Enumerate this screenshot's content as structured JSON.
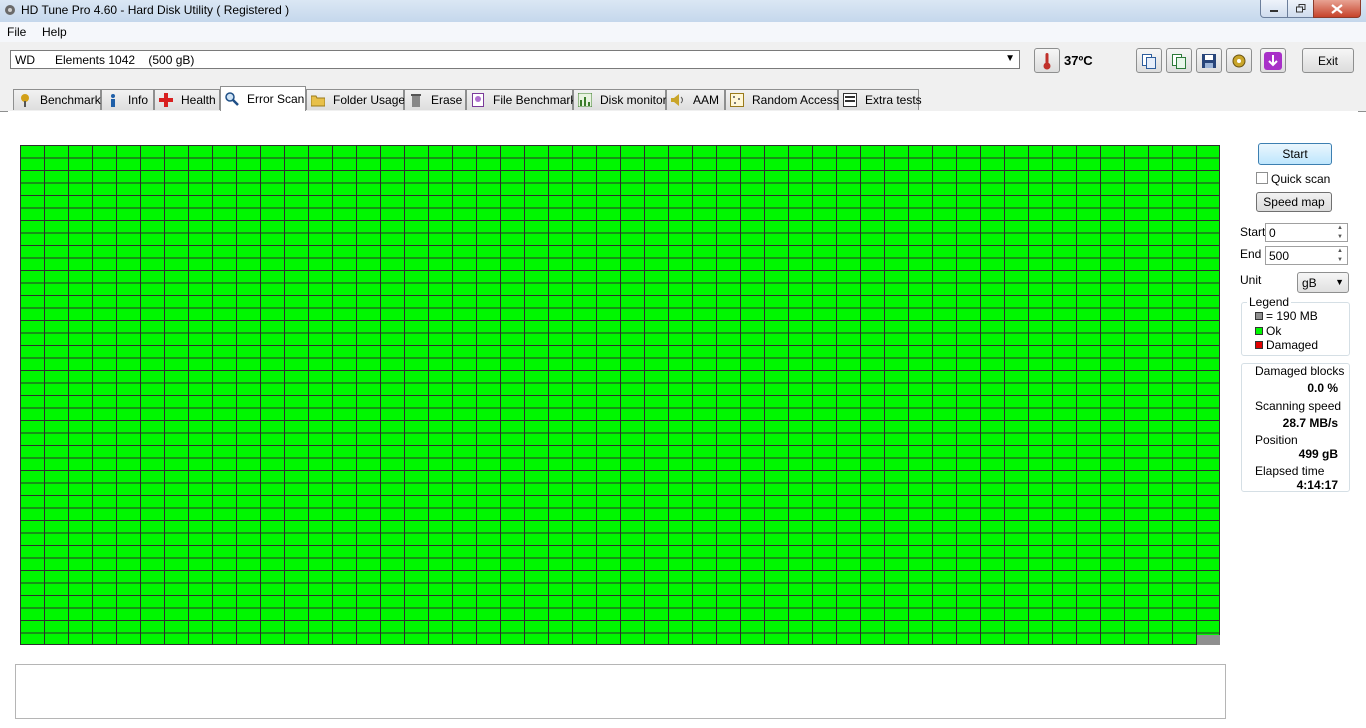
{
  "window": {
    "title": "HD Tune Pro 4.60 - Hard Disk Utility (  Registered )"
  },
  "menu": {
    "file": "File",
    "help": "Help"
  },
  "toolbar": {
    "drive": "WD      Elements 1042    (500 gB)",
    "temperature": "37ºC",
    "exit_label": "Exit"
  },
  "tabs": [
    {
      "label": "Benchmark",
      "icon": "benchmark-icon"
    },
    {
      "label": "Info",
      "icon": "info-icon"
    },
    {
      "label": "Health",
      "icon": "health-icon"
    },
    {
      "label": "Error Scan",
      "icon": "magnifier-icon",
      "active": true
    },
    {
      "label": "Folder Usage",
      "icon": "folder-icon"
    },
    {
      "label": "Erase",
      "icon": "trash-icon"
    },
    {
      "label": "File Benchmark",
      "icon": "file-benchmark-icon"
    },
    {
      "label": "Disk monitor",
      "icon": "disk-monitor-icon"
    },
    {
      "label": "AAM",
      "icon": "speaker-icon"
    },
    {
      "label": "Random Access",
      "icon": "random-access-icon"
    },
    {
      "label": "Extra tests",
      "icon": "extra-tests-icon"
    }
  ],
  "scan": {
    "start_label": "Start",
    "quick_scan_label": "Quick scan",
    "quick_scan_checked": false,
    "speed_map_label": "Speed map",
    "start_field_label": "Start",
    "start_value": "0",
    "end_field_label": "End",
    "end_value": "500",
    "unit_label": "Unit",
    "unit_value": "gB",
    "grid_status": "all blocks ok; last block pending",
    "colors": {
      "ok": "#00f700",
      "damaged": "#e00000",
      "block": "#8f8f8f"
    }
  },
  "legend": {
    "title": "Legend",
    "block": "= 190 MB",
    "ok": "Ok",
    "damaged": "Damaged"
  },
  "stats": {
    "damaged_blocks_label": "Damaged blocks",
    "damaged_blocks_value": "0.0 %",
    "scanning_speed_label": "Scanning speed",
    "scanning_speed_value": "28.7 MB/s",
    "position_label": "Position",
    "position_value": "499 gB",
    "elapsed_label": "Elapsed time",
    "elapsed_value": "4:14:17"
  }
}
